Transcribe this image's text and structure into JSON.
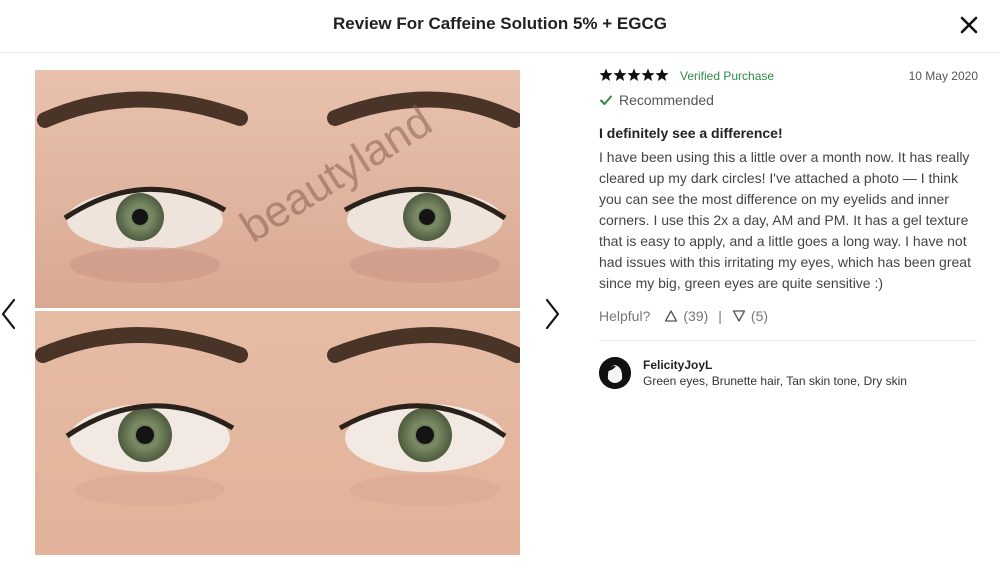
{
  "header": {
    "title": "Review For Caffeine Solution 5% + EGCG"
  },
  "icons": {
    "close": "close-icon",
    "prev": "chevron-left-icon",
    "next": "chevron-right-icon"
  },
  "photo": {
    "watermark": "beautyland"
  },
  "review": {
    "rating": 5,
    "verified_label": "Verified Purchase",
    "date": "10 May 2020",
    "recommended_label": "Recommended",
    "headline": "I definitely see a difference!",
    "body": "I have been using this a little over a month now. It has really cleared up my dark circles! I've attached a photo — I think you can see the most difference on my eyelids and inner corners. I use this 2x a day, AM and PM. It has a gel texture that is easy to apply, and a little goes a long way. I have not had issues with this irritating my eyes, which has been great since my big, green eyes are quite sensitive :)",
    "helpful_label": "Helpful?",
    "upvotes": "(39)",
    "separator": "|",
    "downvotes": "(5)"
  },
  "author": {
    "name": "FelicityJoyL",
    "attributes": "Green eyes, Brunette hair, Tan skin tone, Dry skin"
  },
  "colors": {
    "star": "#111111",
    "verified": "#2f8a46",
    "divider": "#ececec"
  }
}
